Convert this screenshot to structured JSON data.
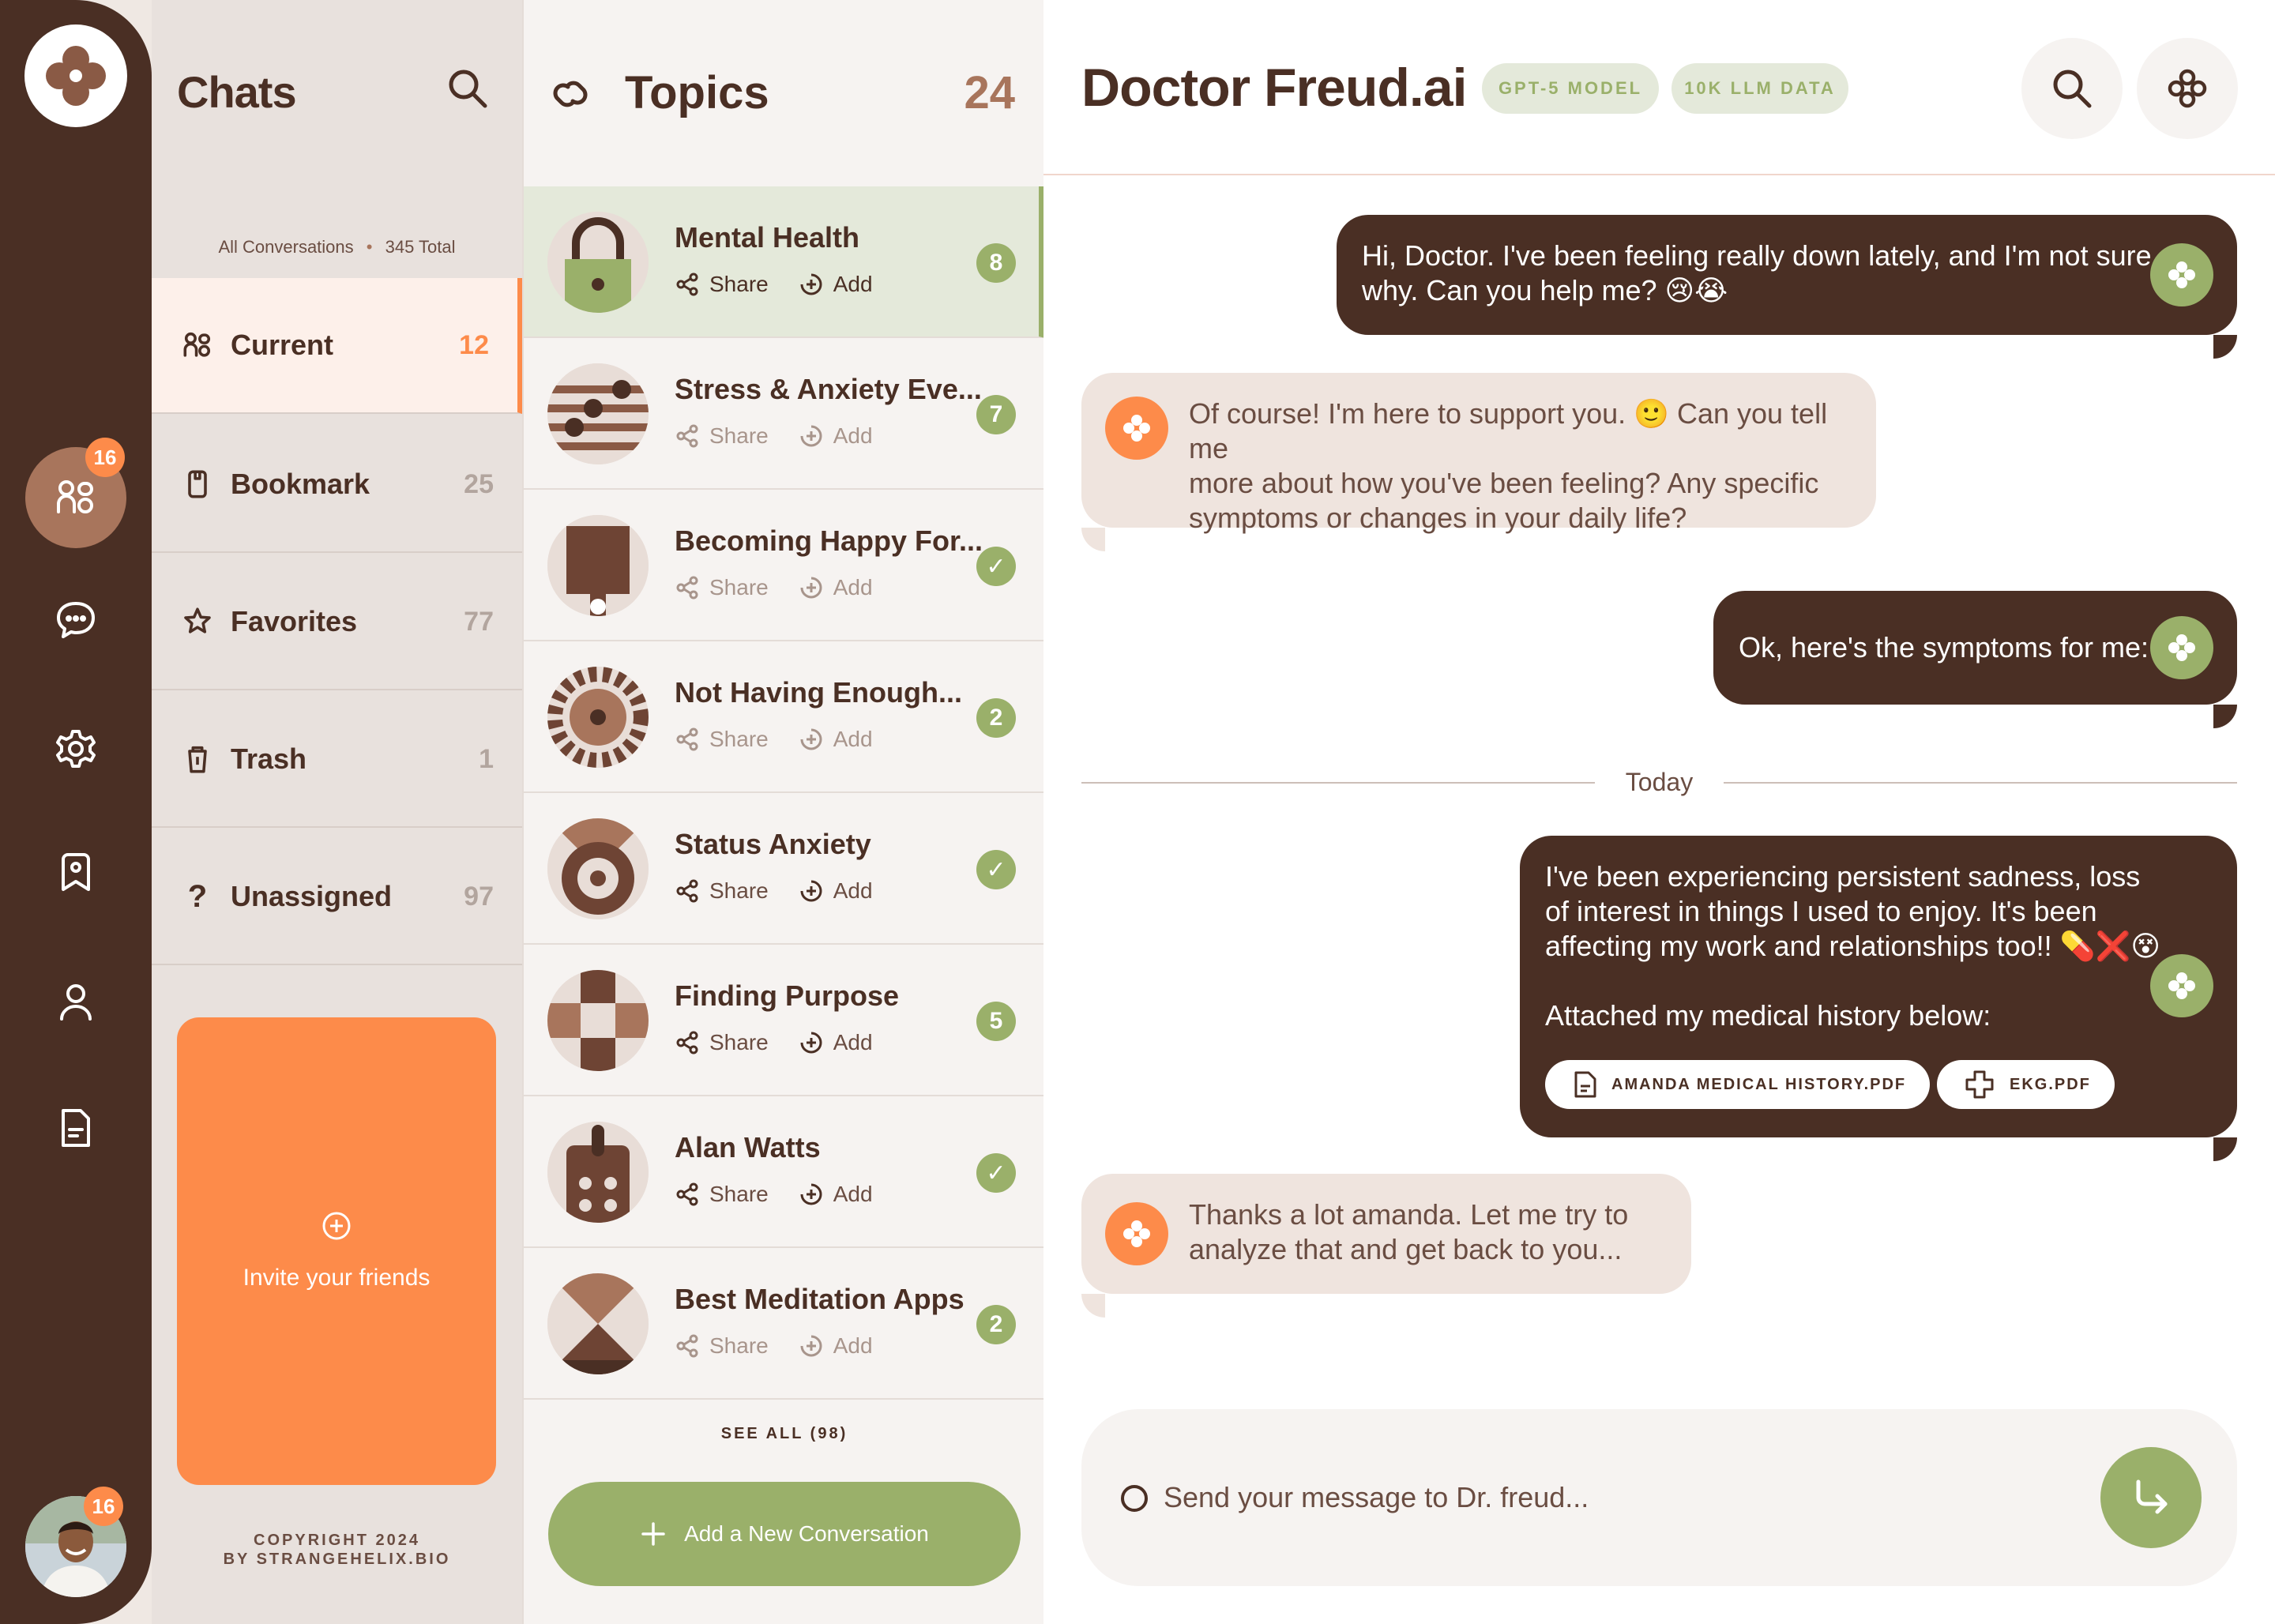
{
  "rail": {
    "nav_badge": "16",
    "avatar_badge": "16",
    "icons": [
      "flower-logo-icon",
      "contacts-icon",
      "chat-bubble-icon",
      "gear-icon",
      "bookmark-icon",
      "user-icon",
      "document-icon"
    ]
  },
  "chats": {
    "title": "Chats",
    "meta_all": "All Conversations",
    "meta_total": "345 Total",
    "folders": [
      {
        "label": "Current",
        "count": "12"
      },
      {
        "label": "Bookmark",
        "count": "25"
      },
      {
        "label": "Favorites",
        "count": "77"
      },
      {
        "label": "Trash",
        "count": "1"
      },
      {
        "label": "Unassigned",
        "count": "97"
      }
    ],
    "invite_label": "Invite your friends",
    "copyright_1": "COPYRIGHT 2024",
    "copyright_2": "BY STRANGEHELIX.BIO"
  },
  "topics": {
    "title": "Topics",
    "count": "24",
    "share_label": "Share",
    "add_label": "Add",
    "items": [
      {
        "name": "Mental Health",
        "badge": "8"
      },
      {
        "name": "Stress & Anxiety Eve...",
        "badge": "7"
      },
      {
        "name": "Becoming Happy For...",
        "badge": "✓"
      },
      {
        "name": "Not Having Enough...",
        "badge": "2"
      },
      {
        "name": "Status Anxiety",
        "badge": "✓"
      },
      {
        "name": "Finding Purpose",
        "badge": "5"
      },
      {
        "name": "Alan Watts",
        "badge": "✓"
      },
      {
        "name": "Best Meditation Apps",
        "badge": "2"
      }
    ],
    "see_all": "SEE ALL (98)",
    "add_conversation": "Add a New Conversation"
  },
  "chat": {
    "title": "Doctor Freud.ai",
    "pill_model": "GPT-5 MODEL",
    "pill_data": "10K LLM DATA",
    "messages": [
      {
        "dir": "out",
        "text_1": "Hi, Doctor. I've been feeling really down lately, and I'm not sure",
        "text_2": "why. Can you help me? 😢😭"
      },
      {
        "dir": "in",
        "text_1": "Of course! I'm here to support you. 🙂 Can you tell me",
        "text_2": "more about how you've been feeling? Any specific",
        "text_3": "symptoms or changes in your daily life?"
      },
      {
        "dir": "out",
        "text_1": "Ok, here's the symptoms for me:"
      },
      {
        "dir": "out",
        "text_1": "I've been experiencing persistent sadness, loss",
        "text_2": "of interest in things I used to enjoy. It's been",
        "text_3": "affecting my work and relationships too!! 💊❌😵",
        "text_4": "Attached my medical history below:"
      },
      {
        "dir": "in",
        "text_1": "Thanks a lot amanda. Let me try to",
        "text_2": "analyze that and get back to you..."
      }
    ],
    "attachments": [
      "AMANDA MEDICAL HISTORY.PDF",
      "EKG.PDF"
    ],
    "divider": "Today",
    "composer_placeholder": "Send your message to Dr. freud..."
  },
  "colors": {
    "brown": "#4a2f24",
    "orange": "#fd8b4a",
    "green": "#9ab06a",
    "cream": "#efe4de"
  }
}
